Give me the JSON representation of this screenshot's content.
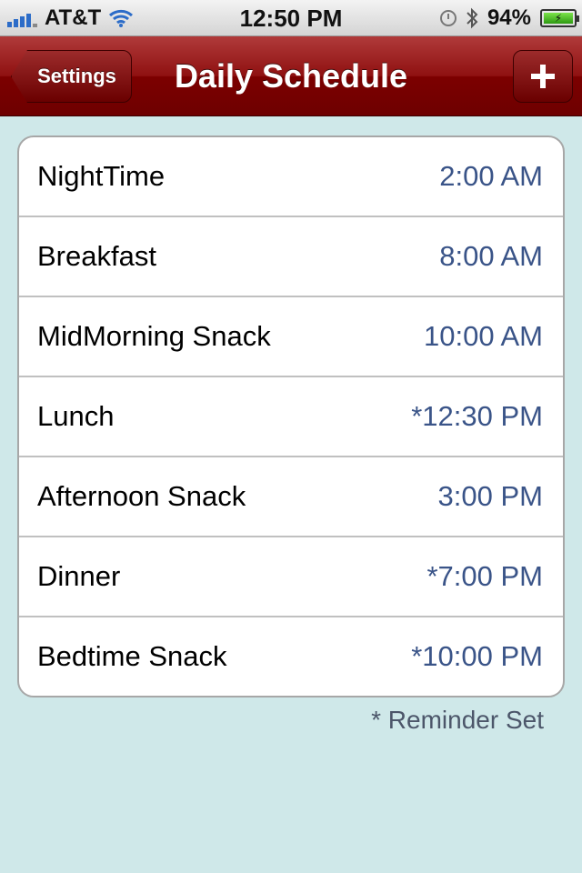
{
  "status_bar": {
    "carrier": "AT&T",
    "time": "12:50 PM",
    "battery": "94%"
  },
  "nav": {
    "back_label": "Settings",
    "title": "Daily Schedule",
    "add_icon": "plus-icon"
  },
  "schedule": [
    {
      "label": "NightTime",
      "time": "2:00 AM"
    },
    {
      "label": "Breakfast",
      "time": "8:00 AM"
    },
    {
      "label": "MidMorning Snack",
      "time": "10:00 AM"
    },
    {
      "label": "Lunch",
      "time": "*12:30 PM"
    },
    {
      "label": "Afternoon Snack",
      "time": "3:00 PM"
    },
    {
      "label": "Dinner",
      "time": "*7:00 PM"
    },
    {
      "label": "Bedtime Snack",
      "time": "*10:00 PM"
    }
  ],
  "footnote": "* Reminder Set",
  "colors": {
    "nav_red": "#8f1111",
    "background": "#cfe8e9",
    "time_blue": "#3a5488"
  }
}
